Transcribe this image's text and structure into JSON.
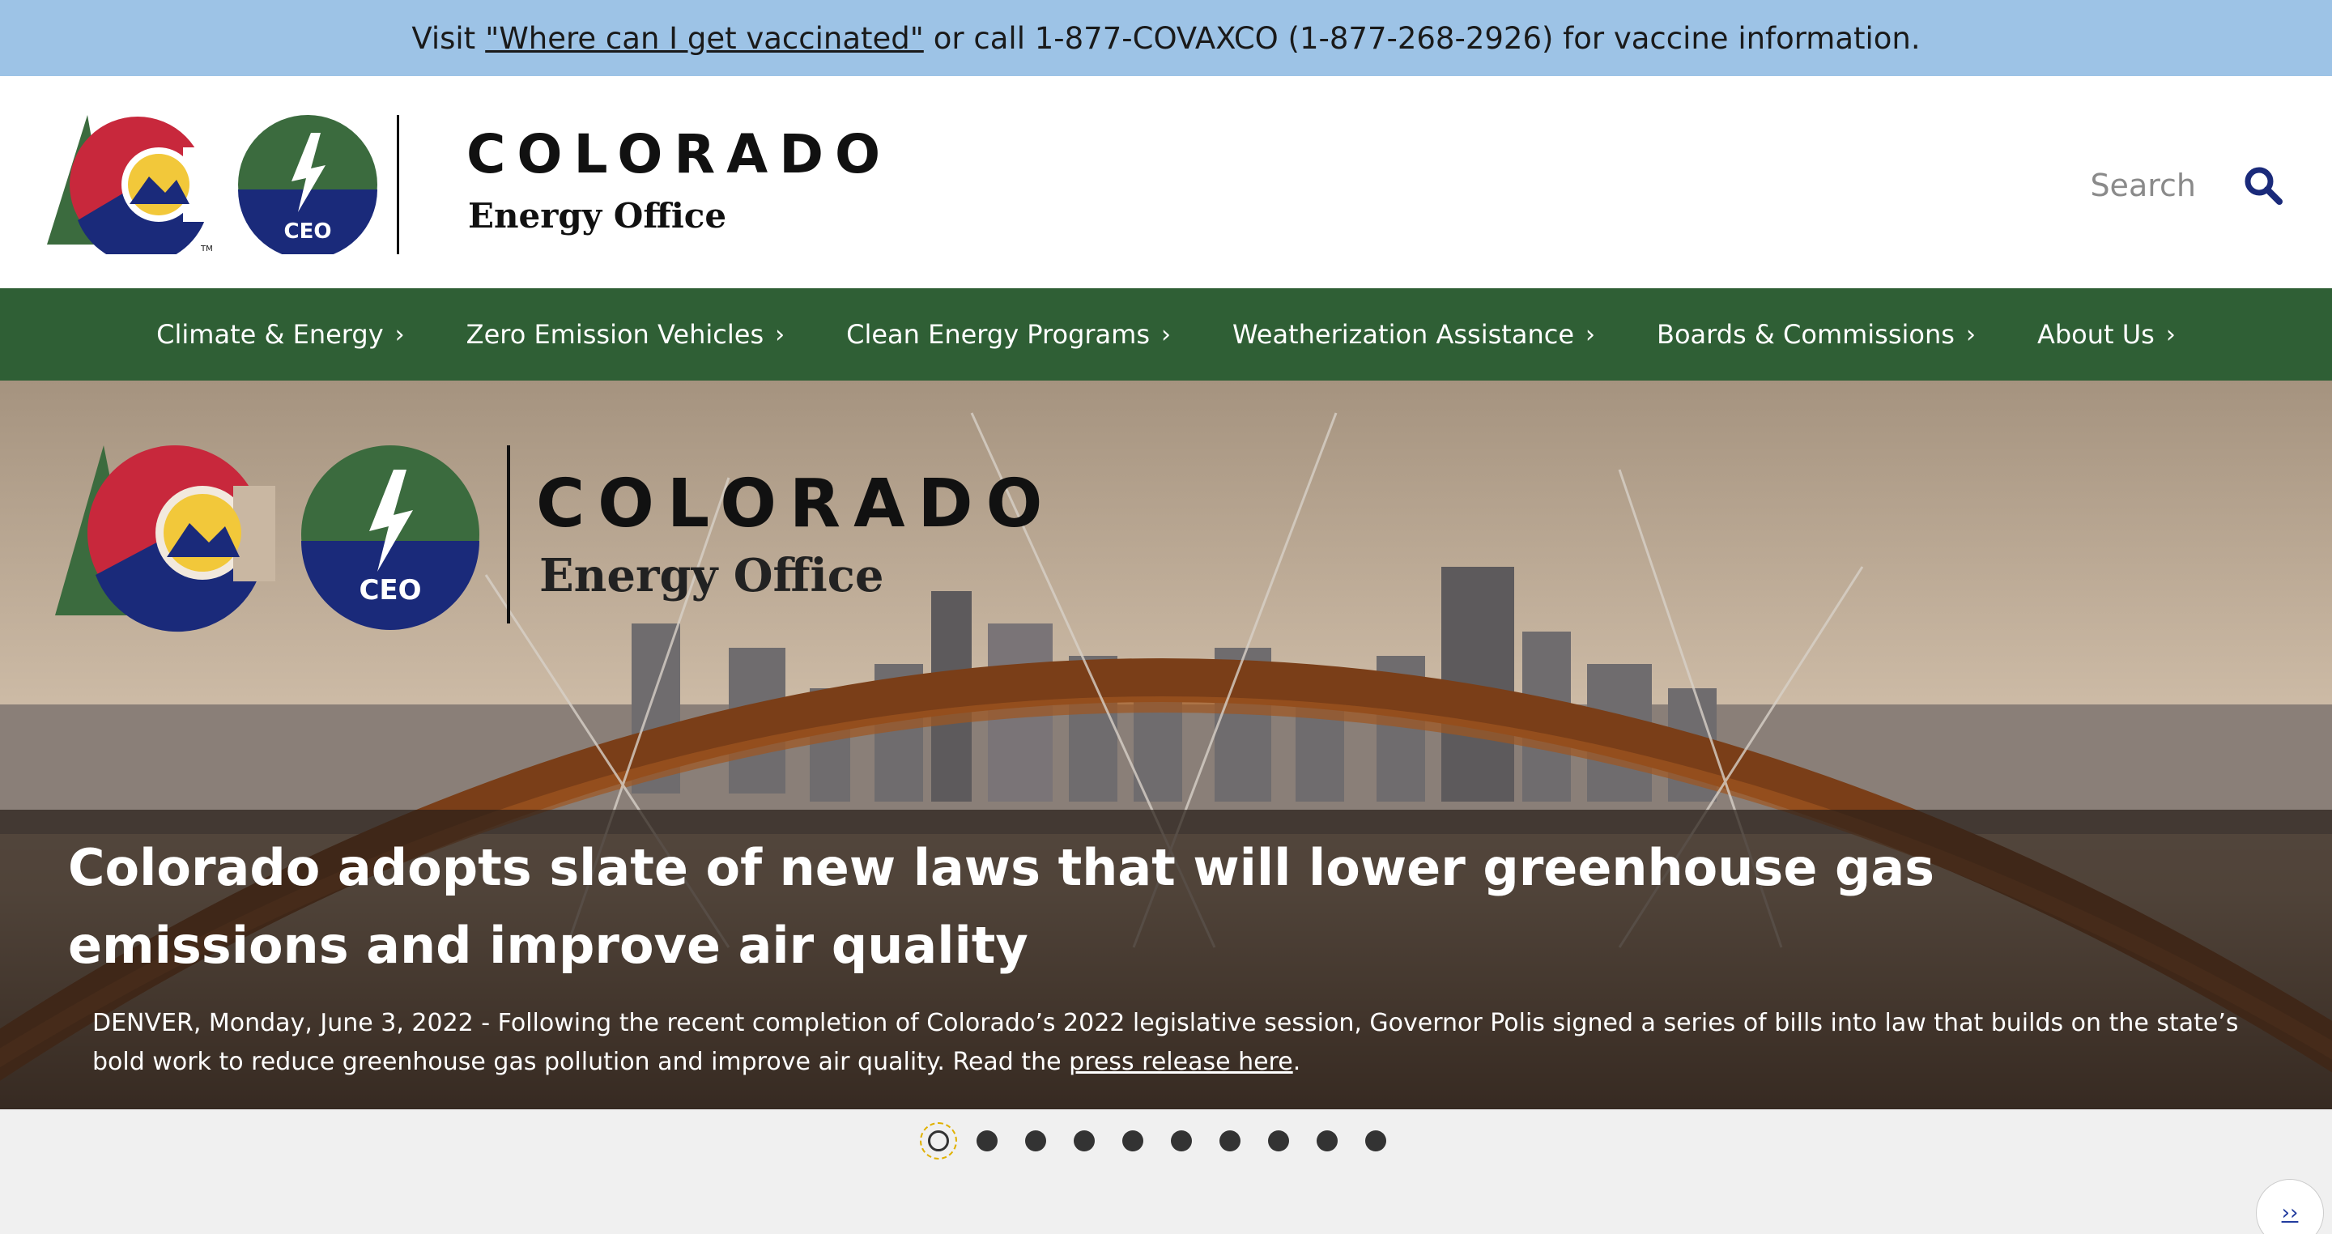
{
  "alert": {
    "prefix": "Visit",
    "link": "\"Where can I get vaccinated\"",
    "suffix": "or call 1-877-COVAXCO (1-877-268-2926) for vaccine information."
  },
  "brand": {
    "name": "COLORADO",
    "subtitle": "Energy Office",
    "badge": "CEO",
    "tm": "TM"
  },
  "search": {
    "placeholder": "Search"
  },
  "nav": {
    "items": [
      {
        "label": "Climate & Energy"
      },
      {
        "label": "Zero Emission Vehicles"
      },
      {
        "label": "Clean Energy Programs"
      },
      {
        "label": "Weatherization Assistance"
      },
      {
        "label": "Boards & Commissions"
      },
      {
        "label": "About Us"
      }
    ]
  },
  "hero": {
    "title": "Colorado adopts slate of new laws that will lower greenhouse gas emissions and improve air quality",
    "body": "DENVER, Monday, June 3, 2022 - Following the recent completion of Colorado’s 2022 legislative session, Governor Polis signed a series of bills into law that builds on the state’s bold work to reduce greenhouse gas pollution and improve air quality. Read the",
    "link": "press release here",
    "period": "."
  },
  "carousel": {
    "slide_count": 10,
    "active_index": 0,
    "next_label": "››"
  },
  "colors": {
    "alert_bg": "#9dc3e6",
    "nav_bg": "#2f5f35",
    "logo_red": "#c8283c",
    "logo_blue": "#1a2a7a",
    "logo_green": "#3b6b3e",
    "logo_yellow": "#f2c83a",
    "search_icon": "#1a2a7a"
  }
}
